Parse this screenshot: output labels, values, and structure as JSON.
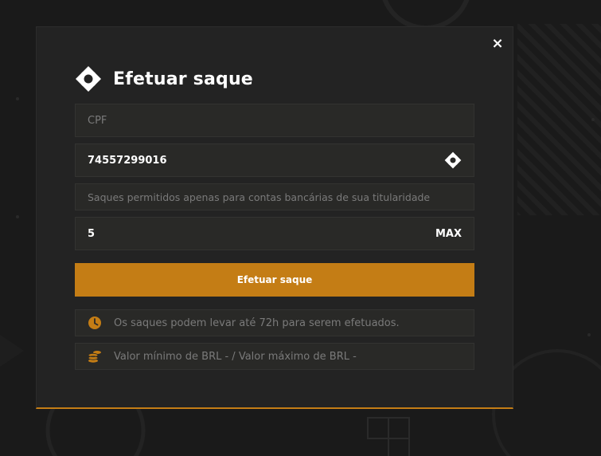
{
  "colors": {
    "accent": "#c47d15",
    "modal_bg": "#232323",
    "field_bg": "#292927",
    "muted_text": "#7a7a7a"
  },
  "modal": {
    "close_label": "×",
    "title": "Efetuar saque",
    "title_icon": "pix-logo-icon",
    "fields": {
      "cpf": {
        "placeholder": "CPF",
        "value": ""
      },
      "pix_key": {
        "value": "74557299016",
        "icon": "pix-logo-icon"
      },
      "notice": "Saques permitidos apenas para contas bancárias de sua titularidade",
      "amount": {
        "value": "5",
        "max_label": "MAX"
      }
    },
    "submit_label": "Efetuar saque",
    "info": [
      {
        "icon": "clock-icon",
        "text": "Os saques podem levar até 72h para serem efetuados."
      },
      {
        "icon": "coins-icon",
        "text": "Valor mínimo de BRL - / Valor máximo de BRL -"
      }
    ]
  }
}
